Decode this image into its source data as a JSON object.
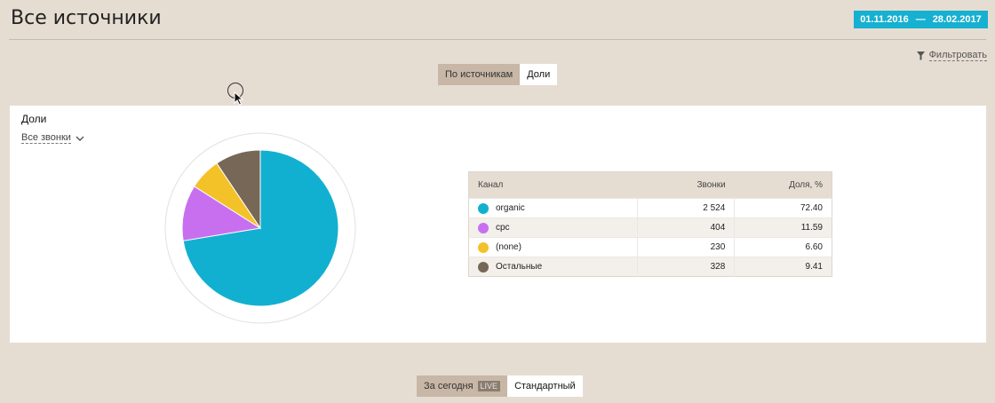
{
  "header": {
    "title": "Все источники",
    "date_from": "01.11.2016",
    "date_sep": "—",
    "date_to": "28.02.2017"
  },
  "filter": {
    "label": "Фильтровать",
    "icon": "funnel-icon"
  },
  "view_toggle": {
    "by_sources": "По источникам",
    "shares": "Доли",
    "active": "shares"
  },
  "card": {
    "title": "Доли",
    "dropdown_value": "Все звонки"
  },
  "table": {
    "headers": [
      "Канал",
      "Звонки",
      "Доля, %"
    ],
    "rows": [
      {
        "channel": "organic",
        "calls": "2 524",
        "share": "72.40",
        "color": "#12b0d0"
      },
      {
        "channel": "cpc",
        "calls": "404",
        "share": "11.59",
        "color": "#c86ff0"
      },
      {
        "channel": "(none)",
        "calls": "230",
        "share": "6.60",
        "color": "#f3c228"
      },
      {
        "channel": "Остальные",
        "calls": "328",
        "share": "9.41",
        "color": "#766757"
      }
    ]
  },
  "chart_data": {
    "type": "pie",
    "categories": [
      "organic",
      "cpc",
      "(none)",
      "Остальные"
    ],
    "values": [
      72.4,
      11.59,
      6.6,
      9.41
    ],
    "colors": [
      "#12b0d0",
      "#c86ff0",
      "#f3c228",
      "#766757"
    ]
  },
  "period_toggle": {
    "today": "За сегодня",
    "live": "LIVE",
    "standard": "Стандартный",
    "active": "standard"
  }
}
